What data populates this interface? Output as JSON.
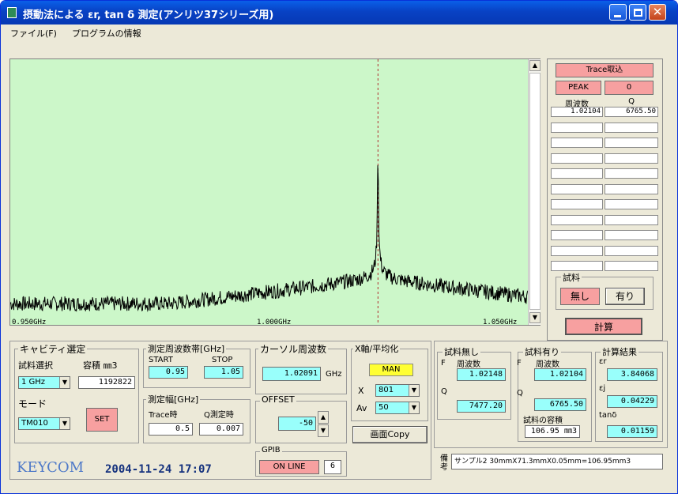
{
  "window": {
    "title": "摂動法による εr, tan δ 測定(アンリツ37シリーズ用)"
  },
  "menu": [
    "ファイル(F)",
    "プログラムの情報"
  ],
  "plot": {
    "x_ticks": [
      "0.950GHz",
      "1.000GHz",
      "1.050GHz"
    ]
  },
  "chart_data": {
    "type": "line",
    "xlim": [
      0.95,
      1.05
    ],
    "ylim": [
      0,
      1
    ],
    "center_frequency_ghz": 1.02104,
    "q": 6765.5,
    "grid": false
  },
  "right_panel": {
    "trace_button": "Trace取込",
    "peak_label": "PEAK",
    "peak_value": "0",
    "freq_header": "周波数",
    "q_header": "Q",
    "rows": [
      [
        "1.02104",
        "6765.50"
      ],
      [
        "",
        ""
      ],
      [
        "",
        ""
      ],
      [
        "",
        ""
      ],
      [
        "",
        ""
      ],
      [
        "",
        ""
      ],
      [
        "",
        ""
      ],
      [
        "",
        ""
      ],
      [
        "",
        ""
      ],
      [
        "",
        ""
      ],
      [
        "",
        ""
      ]
    ],
    "sample_group": "試料",
    "sample_none": "無し",
    "sample_present": "有り",
    "calc_button": "計算"
  },
  "cavity": {
    "group": "キャビティ選定",
    "sample_select_label": "試料選択",
    "volume_label": "容積 ㎜3",
    "sample_select_value": "1 GHz",
    "volume_value": "1192822",
    "mode_label": "モード",
    "mode_value": "TM010",
    "set_button": "SET"
  },
  "freq_band": {
    "group": "測定周波数帯[GHz]",
    "start_label": "START",
    "stop_label": "STOP",
    "start_value": "0.95",
    "stop_value": "1.05"
  },
  "meas_width": {
    "group": "測定幅[GHz]",
    "trace_label": "Trace時",
    "q_label": "Q測定時",
    "trace_value": "0.5",
    "q_value": "0.007"
  },
  "cursor": {
    "group": "カーソル周波数",
    "value": "1.02091",
    "unit": "GHz"
  },
  "offset": {
    "group": "OFFSET",
    "value": "-50"
  },
  "xaxis": {
    "group": "X軸/平均化",
    "man_label": "MAN",
    "x_label": "X",
    "x_value": "801",
    "av_label": "Av",
    "av_value": "50"
  },
  "copy_button": "画面Copy",
  "gpib": {
    "group": "GPIB",
    "online": "ON LINE",
    "addr": "6"
  },
  "no_sample": {
    "group": "試料無し",
    "f_label": "F",
    "freq_label": "周波数",
    "freq_value": "1.02148",
    "q_label": "Q",
    "q_value": "7477.20"
  },
  "with_sample": {
    "group": "試料有り",
    "f_label": "F",
    "freq_label": "周波数",
    "freq_value": "1.02104",
    "q_label": "Q",
    "q_value": "6765.50",
    "volume_label": "試料の容積",
    "volume_value": "106.95 ㎜3"
  },
  "results": {
    "group": "計算結果",
    "er_label": "εr",
    "er_value": "3.84068",
    "ej_label": "εj",
    "ej_value": "0.04229",
    "tan_label": "tanδ",
    "tan_value": "0.01159"
  },
  "notes": {
    "label": "備考",
    "value": "サンプル2 30mmX71.3mmX0.05mm=106.95mm3"
  },
  "footer": {
    "brand": "KEYCOM",
    "datetime": "2004-11-24 17:07"
  }
}
